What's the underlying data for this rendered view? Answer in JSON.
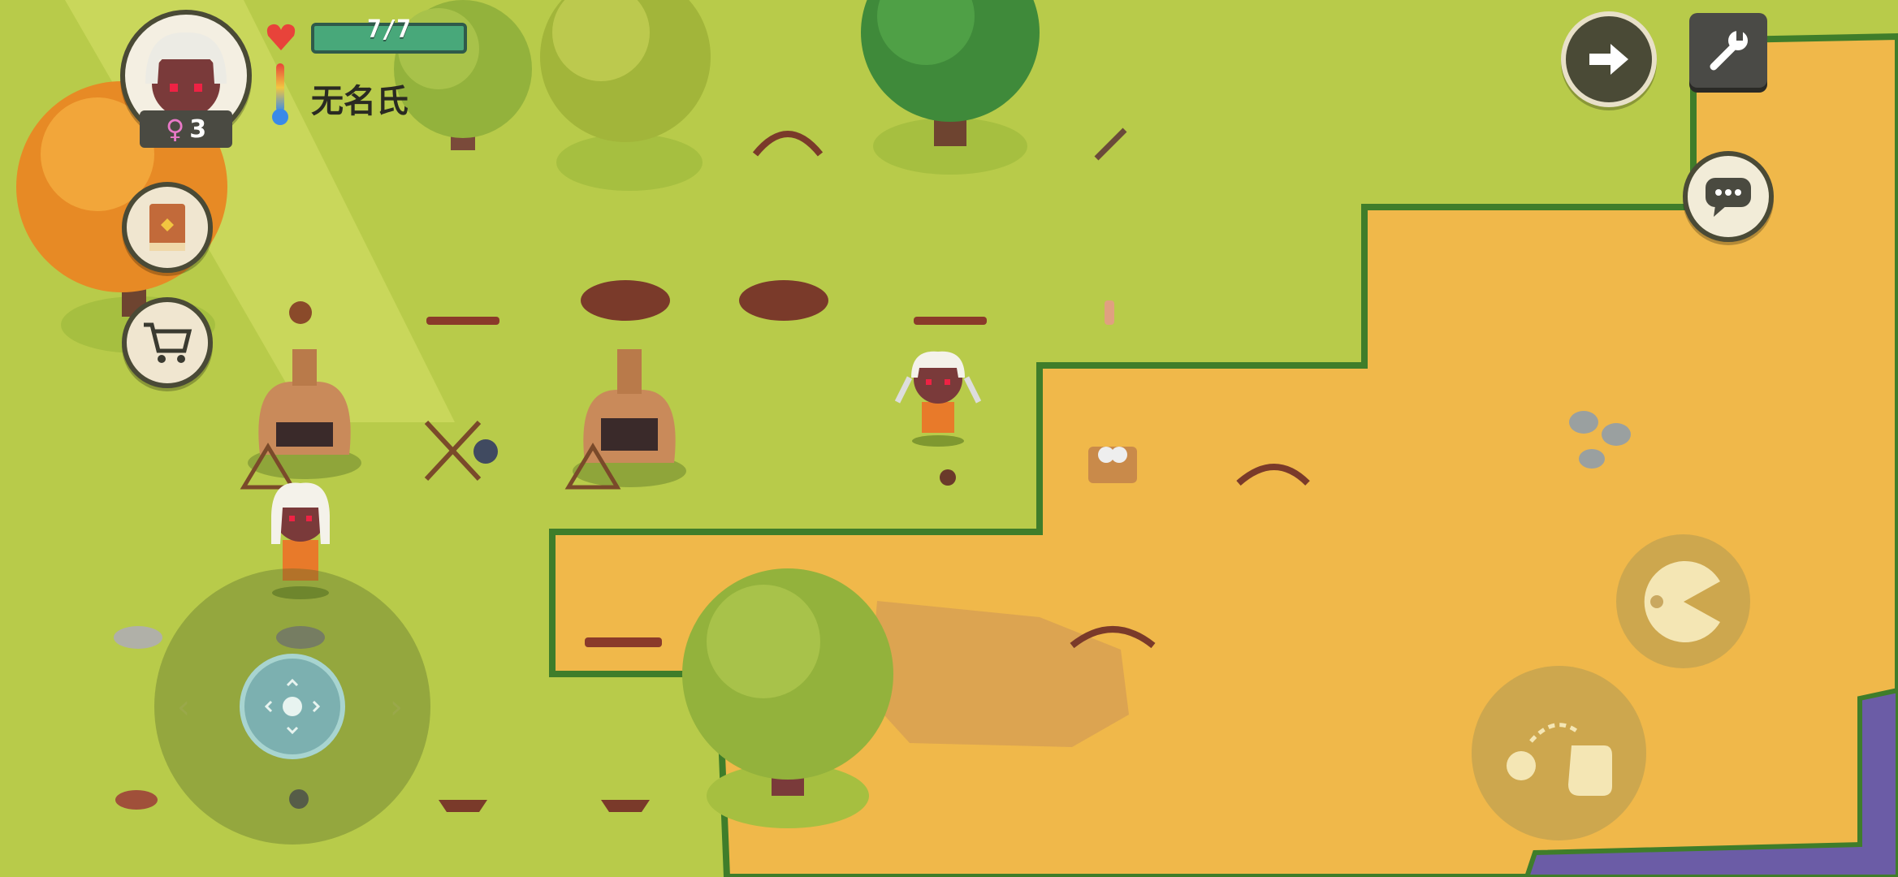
{
  "hud": {
    "health_text": "7/7",
    "player_name": "无名氏",
    "generation_symbol": "♀",
    "generation_count": "3"
  },
  "icons": {
    "heart": "heart-icon",
    "thermometer": "thermometer-icon",
    "next": "arrow-right-icon",
    "settings": "wrench-icon",
    "chat": "chat-bubble-icon",
    "recipe_book": "book-icon",
    "shop": "shopping-cart-icon",
    "eat": "eat-icon",
    "use": "hand-use-icon"
  },
  "colors": {
    "grass": "#b7c94a",
    "sand": "#f0b94a",
    "water": "#6e5fa8",
    "health_bar": "#48a87a",
    "hud_dark": "#4a4a36"
  }
}
